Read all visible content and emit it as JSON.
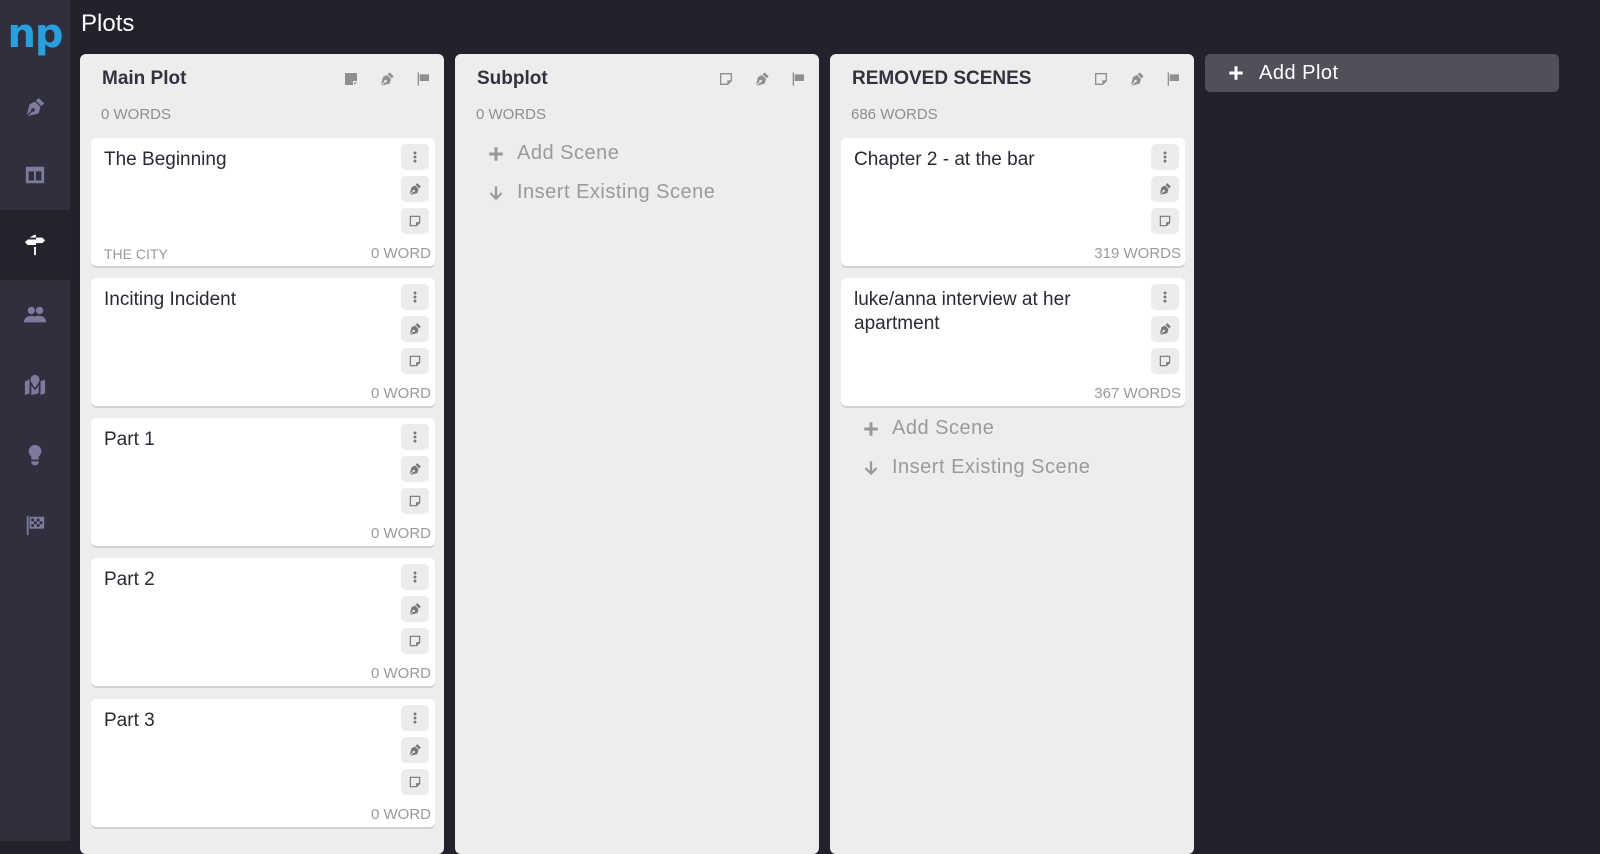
{
  "app": {
    "logo": "np",
    "page_title": "Plots"
  },
  "sidebar": {
    "items": [
      {
        "id": "write",
        "icon": "pen-nib-icon",
        "active": false
      },
      {
        "id": "outline",
        "icon": "columns-icon",
        "active": false
      },
      {
        "id": "plots",
        "icon": "signpost-icon",
        "active": true
      },
      {
        "id": "characters",
        "icon": "users-icon",
        "active": false
      },
      {
        "id": "locations",
        "icon": "map-marker-icon",
        "active": false
      },
      {
        "id": "ideas",
        "icon": "lightbulb-icon",
        "active": false
      },
      {
        "id": "goals",
        "icon": "checkered-flag-icon",
        "active": false
      }
    ]
  },
  "columns": [
    {
      "title": "Main Plot",
      "words": "0 WORDS",
      "cards": [
        {
          "title": "The Beginning",
          "location": "THE CITY",
          "words": "0 WORD"
        },
        {
          "title": "Inciting Incident",
          "location": "",
          "words": "0 WORD"
        },
        {
          "title": "Part 1",
          "location": "",
          "words": "0 WORD"
        },
        {
          "title": "Part 2",
          "location": "",
          "words": "0 WORD"
        },
        {
          "title": "Part 3",
          "location": "",
          "words": "0 WORD"
        }
      ]
    },
    {
      "title": "Subplot",
      "words": "0 WORDS",
      "cards": [],
      "add_scene": "Add Scene",
      "insert_scene": "Insert Existing Scene"
    },
    {
      "title": "REMOVED SCENES",
      "words": "686 WORDS",
      "cards": [
        {
          "title": "Chapter 2 - at the bar",
          "location": "",
          "words": "319 WORDS"
        },
        {
          "title": "luke/anna interview at her apartment",
          "location": "",
          "words": "367 WORDS"
        }
      ],
      "add_scene": "Add Scene",
      "insert_scene": "Insert Existing Scene"
    }
  ],
  "add_plot": {
    "label": "Add Plot"
  }
}
